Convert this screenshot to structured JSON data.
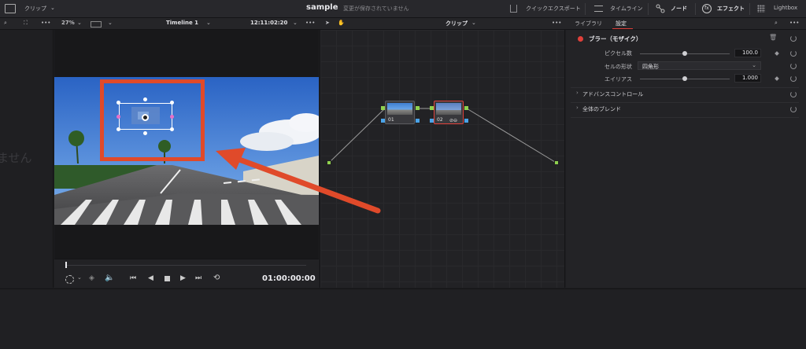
{
  "topbar": {
    "clip_label": "クリップ",
    "project_name": "sample",
    "save_status": "変更が保存されていません",
    "quick_export": "クイックエクスポート",
    "timeline_button": "タイムライン",
    "node_button": "ノード",
    "effects_button": "エフェクト",
    "lightbox_button": "Lightbox"
  },
  "viewer_bar": {
    "zoom": "27%",
    "timeline_name": "Timeline 1",
    "timecode": "12:11:02:20",
    "node_mode": "クリップ"
  },
  "left_panel": {
    "partial_text": "ません"
  },
  "transport": {
    "timecode": "01:00:00:00"
  },
  "nodes": [
    {
      "label": "01"
    },
    {
      "label": "02"
    }
  ],
  "inspector": {
    "tabs": [
      "ライブラリ",
      "設定"
    ],
    "effect_title": "ブラー（モザイク）",
    "params": [
      {
        "label": "ピクセル数",
        "value": "100.0",
        "level": 0.6
      },
      {
        "label": "セルの形状",
        "value": "四角形"
      },
      {
        "label": "エイリアス",
        "value": "1.000",
        "level": 0.6
      }
    ],
    "sections": [
      "アドバンスコントロール",
      "全体のブレンド"
    ]
  },
  "colors": {
    "annotation": "#e04a2a",
    "accent_red": "#e0403a",
    "port_green": "#8fd14f",
    "port_blue": "#4aa3e8"
  }
}
